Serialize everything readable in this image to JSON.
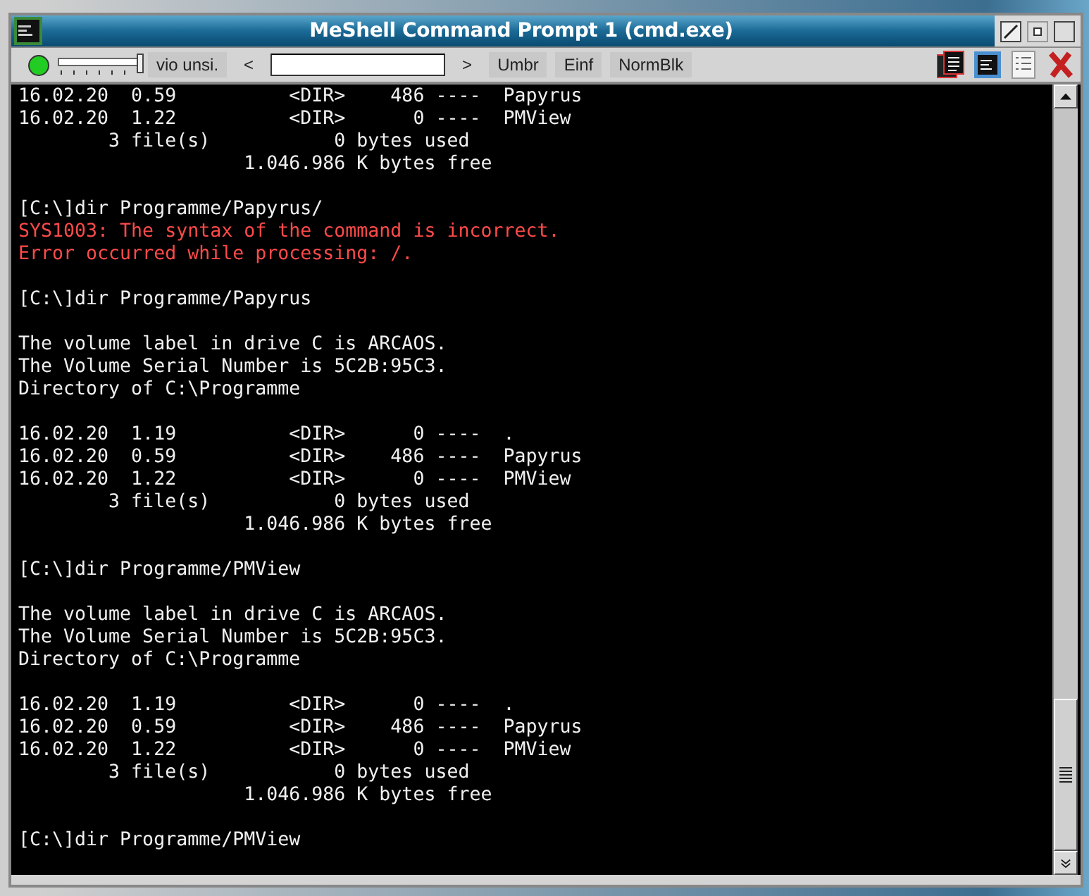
{
  "window": {
    "title": "MeShell Command Prompt 1 (cmd.exe)"
  },
  "toolbar": {
    "status_on": true,
    "slider": {
      "level": 1.0
    },
    "buttons_left": [
      "vio unsi.",
      "<"
    ],
    "buttons_right": [
      ">",
      "Umbr",
      "Einf",
      "NormBlk"
    ]
  },
  "terminal": {
    "lines": [
      {
        "kind": "normal",
        "text": "16.02.20  0.59          <DIR>    486 ----  Papyrus"
      },
      {
        "kind": "normal",
        "text": "16.02.20  1.22          <DIR>      0 ----  PMView"
      },
      {
        "kind": "normal",
        "text": "        3 file(s)           0 bytes used"
      },
      {
        "kind": "normal",
        "text": "                    1.046.986 K bytes free"
      },
      {
        "kind": "blank"
      },
      {
        "kind": "normal",
        "text": "[C:\\]dir Programme/Papyrus/"
      },
      {
        "kind": "error",
        "text": "SYS1003: The syntax of the command is incorrect."
      },
      {
        "kind": "error",
        "text": "Error occurred while processing: /."
      },
      {
        "kind": "blank"
      },
      {
        "kind": "normal",
        "text": "[C:\\]dir Programme/Papyrus"
      },
      {
        "kind": "blank"
      },
      {
        "kind": "normal",
        "text": "The volume label in drive C is ARCAOS."
      },
      {
        "kind": "normal",
        "text": "The Volume Serial Number is 5C2B:95C3."
      },
      {
        "kind": "normal",
        "text": "Directory of C:\\Programme"
      },
      {
        "kind": "blank"
      },
      {
        "kind": "normal",
        "text": "16.02.20  1.19          <DIR>      0 ----  ."
      },
      {
        "kind": "normal",
        "text": "16.02.20  0.59          <DIR>    486 ----  Papyrus"
      },
      {
        "kind": "normal",
        "text": "16.02.20  1.22          <DIR>      0 ----  PMView"
      },
      {
        "kind": "normal",
        "text": "        3 file(s)           0 bytes used"
      },
      {
        "kind": "normal",
        "text": "                    1.046.986 K bytes free"
      },
      {
        "kind": "blank"
      },
      {
        "kind": "normal",
        "text": "[C:\\]dir Programme/PMView"
      },
      {
        "kind": "blank"
      },
      {
        "kind": "normal",
        "text": "The volume label in drive C is ARCAOS."
      },
      {
        "kind": "normal",
        "text": "The Volume Serial Number is 5C2B:95C3."
      },
      {
        "kind": "normal",
        "text": "Directory of C:\\Programme"
      },
      {
        "kind": "blank"
      },
      {
        "kind": "normal",
        "text": "16.02.20  1.19          <DIR>      0 ----  ."
      },
      {
        "kind": "normal",
        "text": "16.02.20  0.59          <DIR>    486 ----  Papyrus"
      },
      {
        "kind": "normal",
        "text": "16.02.20  1.22          <DIR>      0 ----  PMView"
      },
      {
        "kind": "normal",
        "text": "        3 file(s)           0 bytes used"
      },
      {
        "kind": "normal",
        "text": "                    1.046.986 K bytes free"
      },
      {
        "kind": "blank"
      },
      {
        "kind": "normal",
        "text": "[C:\\]dir Programme/PMView"
      }
    ]
  }
}
